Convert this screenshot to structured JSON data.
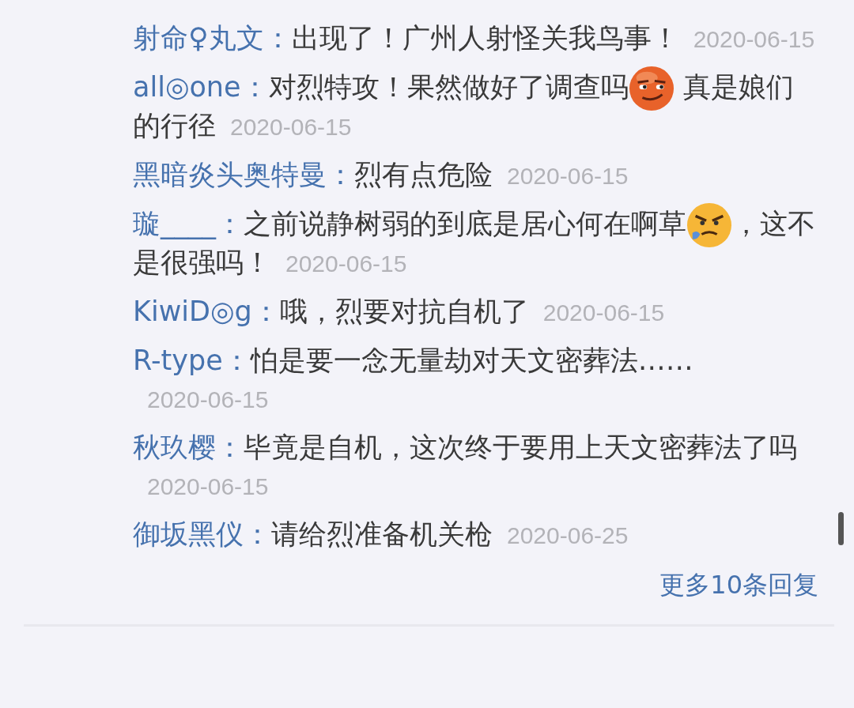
{
  "replies": [
    {
      "user": "射命♀丸文：",
      "content": [
        {
          "kind": "text",
          "text": "出现了！广州人射怪关我鸟事！"
        }
      ],
      "date": "2020-06-15"
    },
    {
      "user": "all◎one：",
      "content": [
        {
          "kind": "text",
          "text": "对烈特攻！果然做好了调查吗"
        },
        {
          "kind": "smirk"
        },
        {
          "kind": "text",
          "text": " 真是娘们的行径"
        }
      ],
      "date": "2020-06-15"
    },
    {
      "user": "黑暗炎头奥特曼：",
      "content": [
        {
          "kind": "text",
          "text": "烈有点危险"
        }
      ],
      "date": "2020-06-15"
    },
    {
      "user": "璇____：",
      "content": [
        {
          "kind": "text",
          "text": "之前说静树弱的到底是居心何在啊草"
        },
        {
          "kind": "angry"
        },
        {
          "kind": "text",
          "text": "，这不是很强吗！"
        }
      ],
      "date": "2020-06-15"
    },
    {
      "user": "KiwiD◎g：",
      "content": [
        {
          "kind": "text",
          "text": "哦，烈要对抗自机了"
        }
      ],
      "date": "2020-06-15"
    },
    {
      "user": "R-type：",
      "content": [
        {
          "kind": "text",
          "text": "怕是要一念无量劫对天文密葬法……"
        }
      ],
      "date": "2020-06-15"
    },
    {
      "user": "秋玖樱：",
      "content": [
        {
          "kind": "text",
          "text": "毕竟是自机，这次终于要用上天文密葬法了吗"
        }
      ],
      "date": "2020-06-15"
    },
    {
      "user": "御坂黑仪：",
      "content": [
        {
          "kind": "text",
          "text": "请给烈准备机关枪"
        }
      ],
      "date": "2020-06-25"
    }
  ],
  "more_link": "更多10条回复"
}
